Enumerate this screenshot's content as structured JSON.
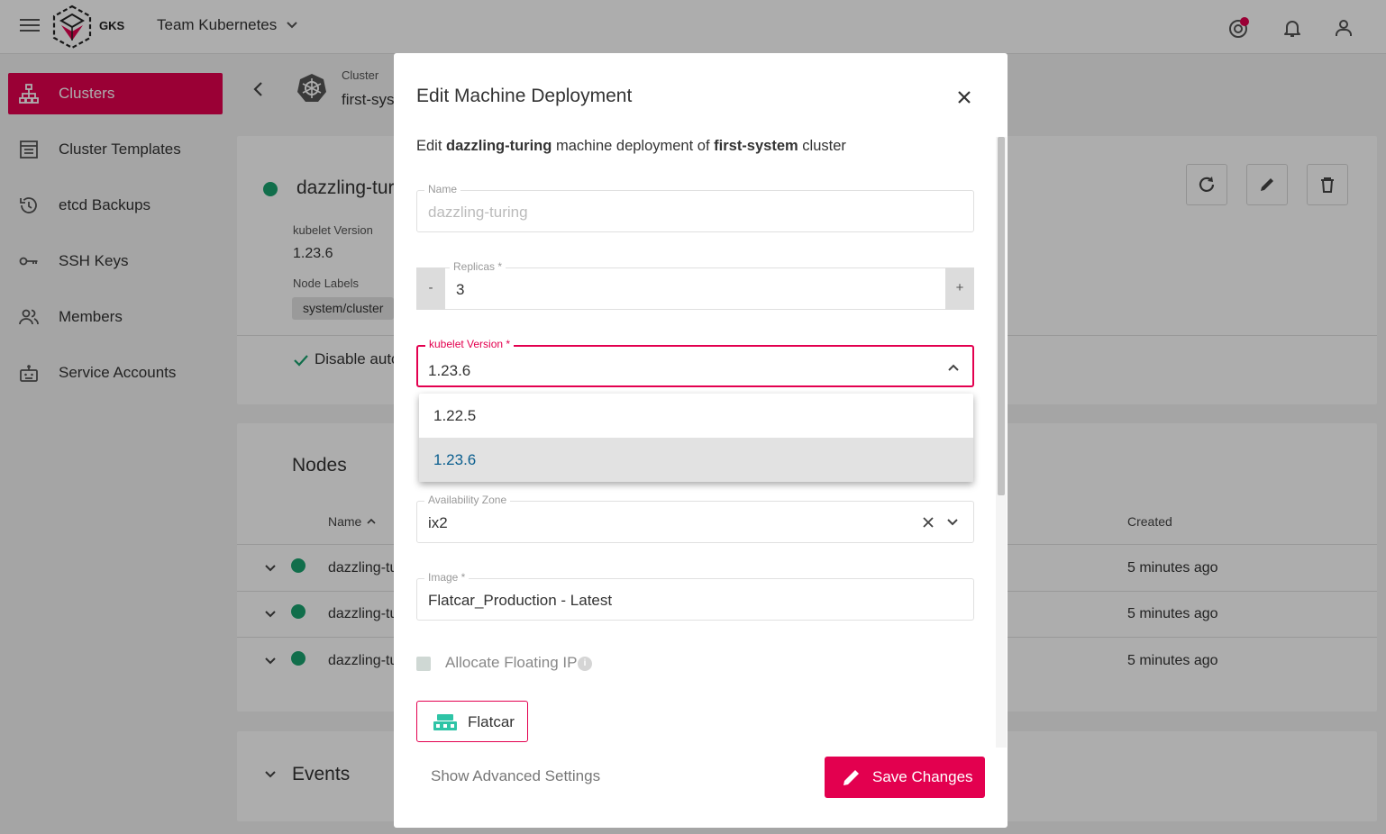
{
  "topbar": {
    "logo_text": "GKS",
    "project": "Team Kubernetes"
  },
  "sidebar": {
    "items": [
      {
        "label": "Clusters",
        "icon": "sitemap-icon",
        "active": true
      },
      {
        "label": "Cluster Templates",
        "icon": "template-icon"
      },
      {
        "label": "etcd Backups",
        "icon": "history-icon"
      },
      {
        "label": "SSH Keys",
        "icon": "key-icon"
      },
      {
        "label": "Members",
        "icon": "people-icon"
      },
      {
        "label": "Service Accounts",
        "icon": "robot-icon"
      }
    ]
  },
  "breadcrumb": {
    "label": "Cluster",
    "value": "first-system"
  },
  "details": {
    "name": "dazzling-turing",
    "kubelet_label": "kubelet Version",
    "kubelet_value": "1.23.6",
    "node_labels_label": "Node Labels",
    "node_label_chip": "system/cluster",
    "disable_text": "Disable auto"
  },
  "nodes": {
    "title": "Nodes",
    "columns": {
      "name": "Name",
      "created": "Created"
    },
    "rows": [
      {
        "name": "dazzling-turing",
        "created": "5 minutes ago"
      },
      {
        "name": "dazzling-turing",
        "created": "5 minutes ago"
      },
      {
        "name": "dazzling-turing",
        "created": "5 minutes ago"
      }
    ]
  },
  "events": {
    "title": "Events"
  },
  "dialog": {
    "title": "Edit Machine Deployment",
    "desc_prefix": "Edit ",
    "desc_md": "dazzling-turing",
    "desc_middle": " machine deployment of ",
    "desc_cluster": "first-system",
    "desc_suffix": " cluster",
    "name_label": "Name",
    "name_value": "dazzling-turing",
    "replicas_label": "Replicas *",
    "replicas_value": "3",
    "replicas_minus": "-",
    "replicas_plus": "+",
    "kubelet_label": "kubelet Version *",
    "kubelet_value": "1.23.6",
    "kubelet_options": [
      "1.22.5",
      "1.23.6"
    ],
    "az_label": "Availability Zone",
    "az_value": "ix2",
    "image_label": "Image *",
    "image_value": "Flatcar_Production - Latest",
    "floating_ip_label": "Allocate Floating IP",
    "floating_ip_checked": false,
    "info_glyph": "i",
    "os_label": "Flatcar",
    "advanced_label": "Show Advanced Settings",
    "save_label": "Save Changes"
  },
  "colors": {
    "accent": "#e3004f",
    "status_ok": "#1aa36f"
  }
}
